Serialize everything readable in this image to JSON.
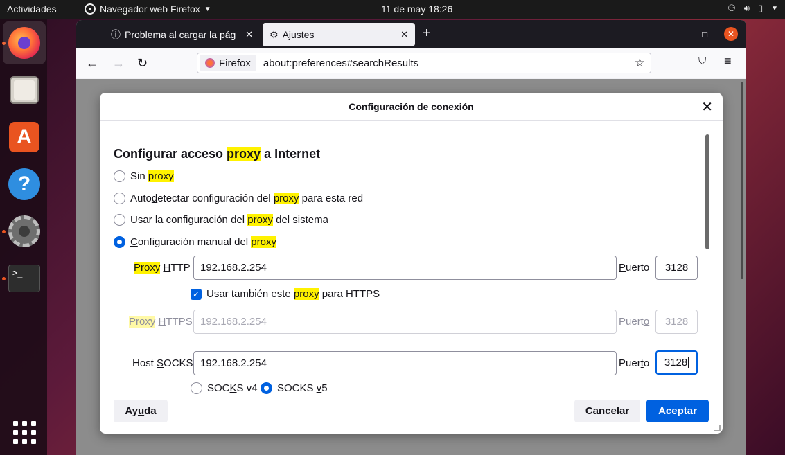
{
  "topbar": {
    "activities": "Actividades",
    "app_name": "Navegador web Firefox",
    "clock": "11 de may  18:26"
  },
  "browser": {
    "tabs": [
      {
        "title": "Problema al cargar la pág",
        "icon": "info-icon",
        "active": false
      },
      {
        "title": "Ajustes",
        "icon": "gear-icon",
        "active": true
      }
    ],
    "url_identity": "Firefox",
    "url": "about:preferences#searchResults"
  },
  "dialog": {
    "title": "Configuración de conexión",
    "section_title_pre": "Configurar acceso ",
    "section_title_hl": "proxy",
    "section_title_post": " a Internet",
    "options": {
      "no_proxy_a": "Sin ",
      "hl": "proxy",
      "auto_a": "Auto",
      "auto_u": "d",
      "auto_b": "etectar configuración del ",
      "auto_c": " para esta red",
      "system_a": "Usar la configuración ",
      "system_u": "d",
      "system_b": "el ",
      "system_c": " del sistema",
      "manual_u": "C",
      "manual_a": "onfiguración manual del "
    },
    "http": {
      "label_hl": "Proxy",
      "label_a": " ",
      "label_u": "H",
      "label_b": "TTP",
      "value": "192.168.2.254",
      "port_label_u": "P",
      "port_label_b": "uerto",
      "port": "3128"
    },
    "also_https": {
      "a": "U",
      "u": "s",
      "b": "ar también este ",
      "hl": "proxy",
      "c": " para HTTPS",
      "checked": true
    },
    "https": {
      "label_hl": "Proxy",
      "label_a": " ",
      "label_u": "H",
      "label_b": "TTPS",
      "value": "192.168.2.254",
      "port_label_a": "Puert",
      "port_label_u": "o",
      "port": "3128"
    },
    "socks": {
      "label_a": "Host ",
      "label_u": "S",
      "label_b": "OCKS",
      "value": "192.168.2.254",
      "port_label_a": "Puer",
      "port_label_u": "t",
      "port_label_b": "o",
      "port": "3128",
      "v4_a": "SOC",
      "v4_u": "K",
      "v4_b": "S v4",
      "v5_a": "SOCKS ",
      "v5_u": "v",
      "v5_b": "5",
      "selected_version": "v5"
    },
    "buttons": {
      "help_a": "Ay",
      "help_u": "u",
      "help_b": "da",
      "cancel": "Cancelar",
      "accept": "Aceptar"
    }
  },
  "colors": {
    "accent": "#0061e0",
    "highlight": "#fff200",
    "ubuntu_orange": "#e95420"
  }
}
